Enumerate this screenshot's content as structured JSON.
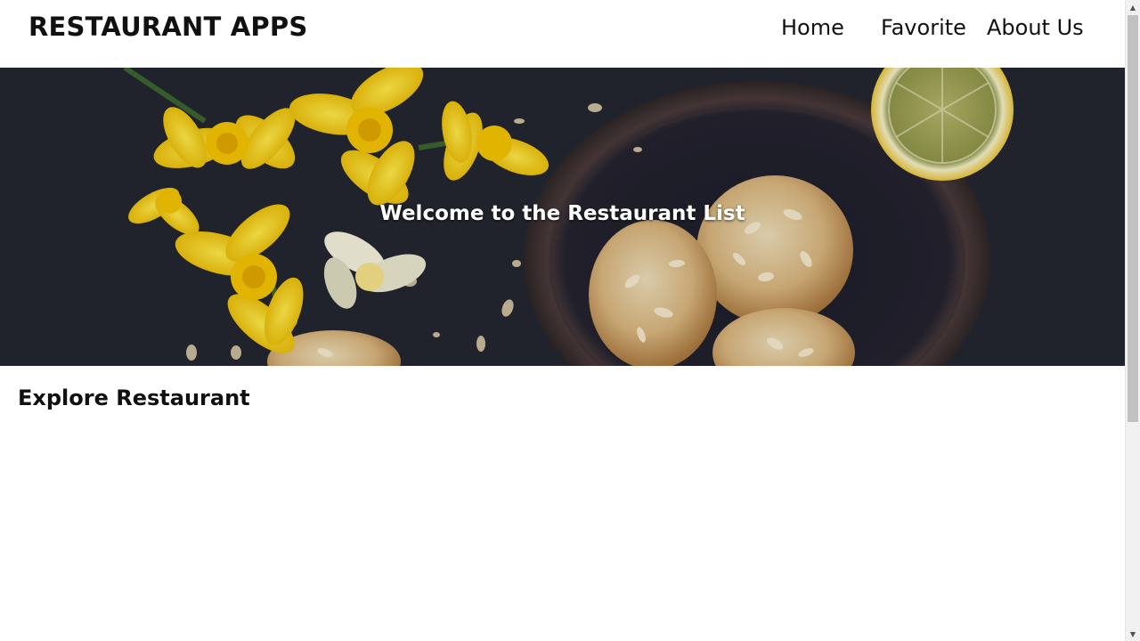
{
  "header": {
    "brand": "RESTAURANT APPS",
    "nav": [
      {
        "label": "Home"
      },
      {
        "label": "Favorite"
      },
      {
        "label": "About Us"
      }
    ]
  },
  "hero": {
    "title": "Welcome to the Restaurant List",
    "image_icon": "food-photo-daffodils-cookies-lemon"
  },
  "main": {
    "section_title": "Explore Restaurant",
    "restaurants": []
  },
  "scrollbar": {
    "up_icon": "chevron-up-icon",
    "down_icon": "chevron-down-icon"
  },
  "colors": {
    "background": "#ffffff",
    "text": "#111111",
    "hero_overlay_text": "#ffffff",
    "hero_dark": "#262830"
  }
}
